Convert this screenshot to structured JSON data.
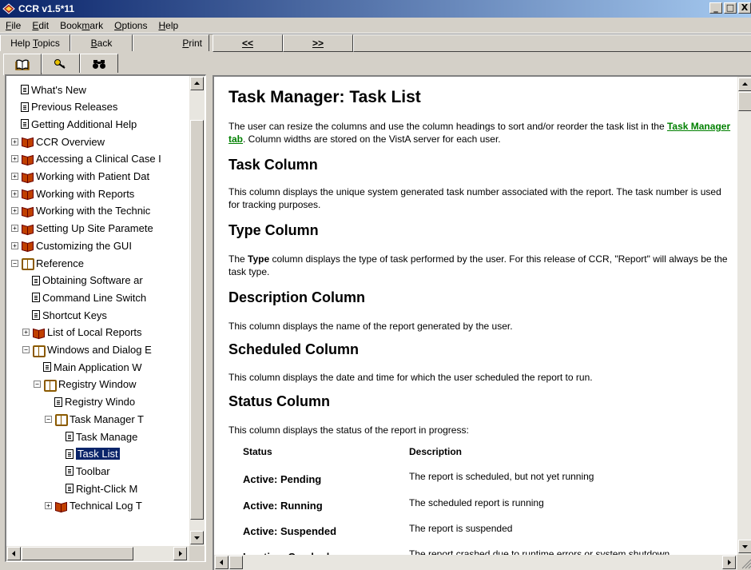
{
  "window": {
    "title": "CCR v1.5*11",
    "controls": {
      "minimize": "_",
      "maximize": "□",
      "close": "X"
    }
  },
  "menu": [
    {
      "label": "File",
      "ul": "F"
    },
    {
      "label": "Edit",
      "ul": "E"
    },
    {
      "label": "Bookmark",
      "ul": "m"
    },
    {
      "label": "Options",
      "ul": "O"
    },
    {
      "label": "Help",
      "ul": "H"
    }
  ],
  "toolbar": {
    "help_topics": "Help Topics",
    "back": "Back",
    "print": "Print",
    "prev": "<<",
    "next": ">>"
  },
  "nav_tabs": [
    {
      "name": "contents",
      "icon": "book-icon"
    },
    {
      "name": "index",
      "icon": "key-icon"
    },
    {
      "name": "search",
      "icon": "binoculars-icon"
    }
  ],
  "tree": [
    {
      "label": "What's New",
      "type": "doc",
      "indent": 0
    },
    {
      "label": "Previous Releases",
      "type": "doc",
      "indent": 0
    },
    {
      "label": "Getting Additional Help",
      "type": "doc",
      "indent": 0
    },
    {
      "label": "CCR Overview",
      "type": "book",
      "indent": 0
    },
    {
      "label": "Accessing a Clinical Case I",
      "type": "book",
      "indent": 0
    },
    {
      "label": "Working with Patient Dat",
      "type": "book",
      "indent": 0
    },
    {
      "label": "Working with Reports",
      "type": "book",
      "indent": 0
    },
    {
      "label": "Working with the Technic",
      "type": "book",
      "indent": 0
    },
    {
      "label": "Setting Up Site Paramete",
      "type": "book",
      "indent": 0
    },
    {
      "label": "Customizing the GUI",
      "type": "book",
      "indent": 0
    },
    {
      "label": "Reference",
      "type": "openbook",
      "indent": 0
    },
    {
      "label": "Obtaining Software ar",
      "type": "doc",
      "indent": 1
    },
    {
      "label": "Command Line Switch",
      "type": "doc",
      "indent": 1
    },
    {
      "label": "Shortcut Keys",
      "type": "doc",
      "indent": 1
    },
    {
      "label": "List of Local Reports",
      "type": "book",
      "indent": 1
    },
    {
      "label": "Windows and Dialog E",
      "type": "openbook",
      "indent": 1
    },
    {
      "label": "Main Application W",
      "type": "doc",
      "indent": 2
    },
    {
      "label": "Registry Window",
      "type": "openbook",
      "indent": 2
    },
    {
      "label": "Registry Windo",
      "type": "doc",
      "indent": 3
    },
    {
      "label": "Task Manager T",
      "type": "openbook",
      "indent": 3
    },
    {
      "label": "Task Manage",
      "type": "doc",
      "indent": 4
    },
    {
      "label": "Task List",
      "type": "doc",
      "indent": 4,
      "selected": true
    },
    {
      "label": "Toolbar",
      "type": "doc",
      "indent": 4
    },
    {
      "label": "Right-Click M",
      "type": "doc",
      "indent": 4
    },
    {
      "label": "Technical Log T",
      "type": "book",
      "indent": 3
    }
  ],
  "content": {
    "title": "Task Manager: Task List",
    "intro_before": "The user can resize the columns and use the column headings to sort and/or reorder the task list in the ",
    "intro_link": "Task Manager tab",
    "intro_after": ".  Column widths are stored on the VistA server for each user.",
    "task_heading": "Task Column",
    "task_text": "This column displays the unique system generated task number associated with the report.  The task number is used for tracking purposes.",
    "type_heading": "Type Column",
    "type_text_before": "The ",
    "type_text_bold": "Type",
    "type_text_after": " column displays the type of task performed by the user.  For this release of CCR, \"Report\" will always be the task type.",
    "desc_heading": "Description Column",
    "desc_text": "This column displays the name of the report generated by the user.",
    "sched_heading": "Scheduled Column",
    "sched_text": "This column displays the date and time for which the user scheduled the report to run.",
    "status_heading": "Status Column",
    "status_text": "This column displays the status of the report in progress:",
    "status_table": {
      "headers": [
        "Status",
        "Description"
      ],
      "rows": [
        [
          "Active: Pending",
          "The report is scheduled, but not yet running"
        ],
        [
          "Active: Running",
          "The scheduled report is running"
        ],
        [
          "Active: Suspended",
          "The report is suspended"
        ],
        [
          "Inactive: Crashed",
          "The report crashed due to runtime errors or system shutdown"
        ]
      ]
    }
  }
}
